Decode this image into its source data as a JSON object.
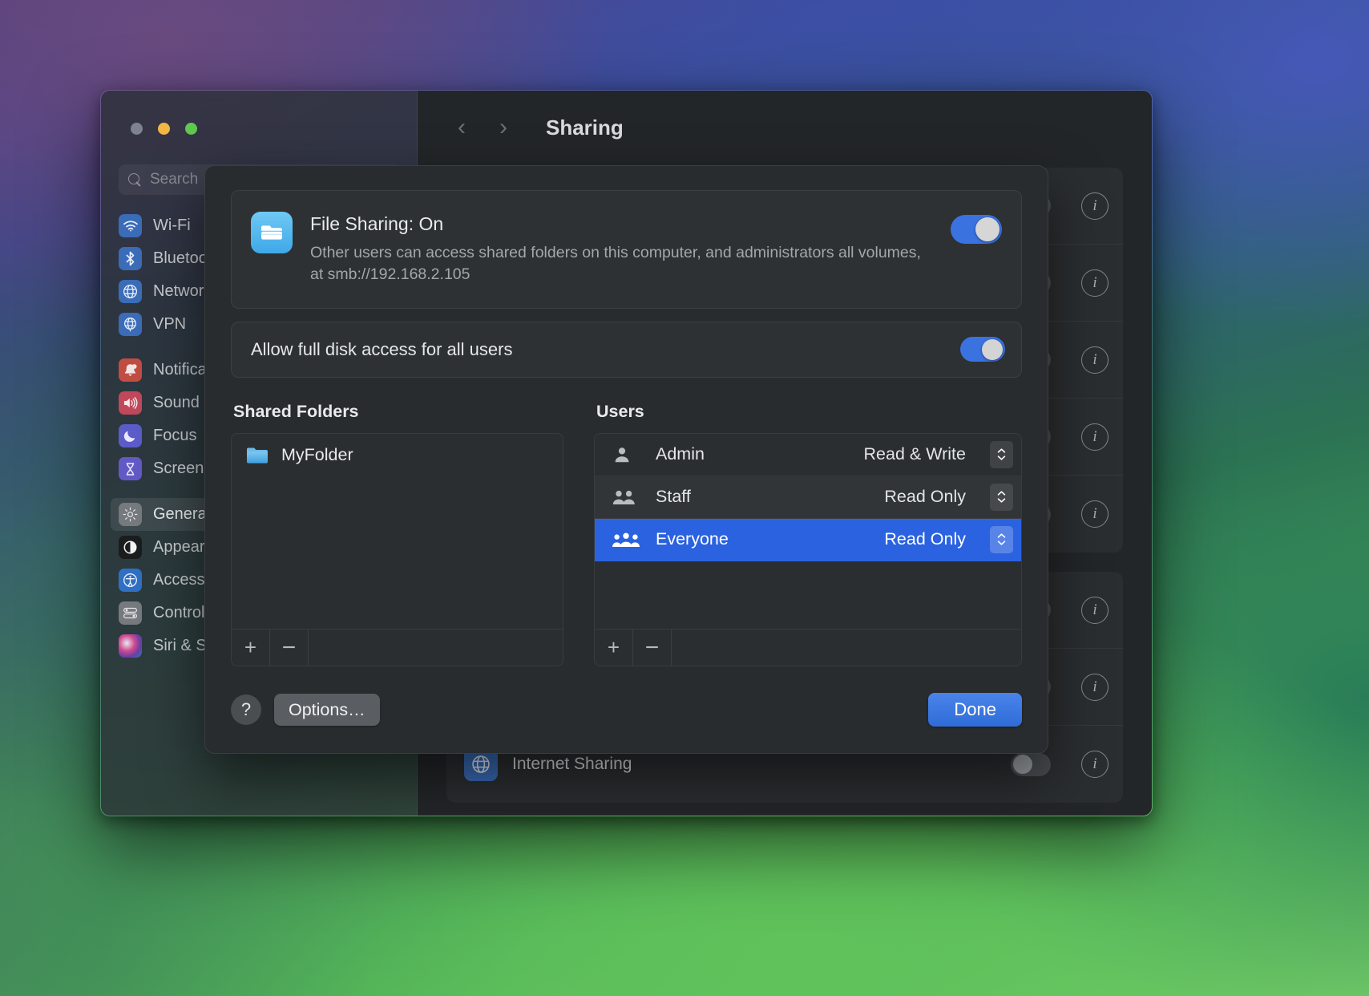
{
  "window": {
    "title": "Sharing",
    "traffic_lights": [
      "close",
      "minimize",
      "zoom"
    ],
    "nav_back": "‹",
    "nav_forward": "›"
  },
  "search": {
    "placeholder": "Search"
  },
  "sidebar": {
    "groups": [
      {
        "items": [
          {
            "label": "Wi-Fi",
            "icon": "wifi-icon",
            "color": "#3a6cb8",
            "glyph": "◔",
            "selected": false
          },
          {
            "label": "Bluetooth",
            "icon": "bluetooth-icon",
            "color": "#3a6cb8",
            "glyph": "ᛦ",
            "selected": false
          },
          {
            "label": "Network",
            "icon": "globe-icon",
            "color": "#3a6cb8",
            "glyph": "ἱ0",
            "selected": false
          },
          {
            "label": "VPN",
            "icon": "vpn-globe-icon",
            "color": "#3a6cb8",
            "glyph": "ἱ0",
            "selected": false
          }
        ]
      },
      {
        "items": [
          {
            "label": "Notifications",
            "icon": "bell-icon",
            "color": "#c14d42",
            "glyph": "ὑ4",
            "selected": false
          },
          {
            "label": "Sound",
            "icon": "speaker-icon",
            "color": "#c0485a",
            "glyph": "ὐa",
            "selected": false
          },
          {
            "label": "Focus",
            "icon": "moon-icon",
            "color": "#5b5bc9",
            "glyph": "ἱ9",
            "selected": false
          },
          {
            "label": "Screen Time",
            "icon": "hourglass-icon",
            "color": "#6359c6",
            "glyph": "⌛",
            "selected": false
          }
        ]
      },
      {
        "items": [
          {
            "label": "General",
            "icon": "gear-icon",
            "color": "#76797d",
            "glyph": "⚙",
            "selected": true
          },
          {
            "label": "Appearance",
            "icon": "contrast-icon",
            "color": "#1b1c1e",
            "glyph": "◑",
            "selected": false
          },
          {
            "label": "Accessibility",
            "icon": "accessibility-icon",
            "color": "#2f6fc4",
            "glyph": "♿",
            "selected": false
          },
          {
            "label": "Control Centre",
            "icon": "sliders-icon",
            "color": "#76797d",
            "glyph": "≣",
            "selected": false
          },
          {
            "label": "Siri & Spotlight",
            "icon": "siri-icon",
            "color": "#9b3a86",
            "glyph": "●",
            "selected": false
          }
        ]
      }
    ]
  },
  "background_rows": [
    {
      "label": "",
      "icon": "generic-icon",
      "color": "#3a6cb8",
      "glyph": "",
      "toggle": "off",
      "info": "i"
    },
    {
      "label": "",
      "icon": "generic-icon",
      "color": "#3a6cb8",
      "glyph": "",
      "toggle": "off",
      "info": "i"
    },
    {
      "label": "",
      "icon": "generic-icon",
      "color": "#3a6cb8",
      "glyph": "",
      "toggle": "off",
      "info": "i"
    },
    {
      "label": "",
      "icon": "generic-icon",
      "color": "#3a6cb8",
      "glyph": "",
      "toggle": "off",
      "info": "i"
    },
    {
      "label": "",
      "icon": "generic-icon",
      "color": "#3a6cb8",
      "glyph": "",
      "toggle": "off",
      "info": "i"
    }
  ],
  "background_rows_2": [
    {
      "label": "",
      "icon": "generic-icon",
      "color": "#3a6cb8",
      "glyph": "",
      "toggle": "off",
      "info": "i"
    },
    {
      "label": "",
      "icon": "generic-icon",
      "color": "#3a6cb8",
      "glyph": "",
      "toggle": "off",
      "info": "i"
    },
    {
      "label": "Internet Sharing",
      "icon": "globe-icon",
      "color": "#3a6cb8",
      "glyph": "ἱ0",
      "toggle": "off",
      "info": "i"
    }
  ],
  "sheet": {
    "file_sharing": {
      "icon": "file-sharing-folder-icon",
      "title": "File Sharing: On",
      "description": "Other users can access shared folders on this computer, and administrators all volumes, at smb://192.168.2.105",
      "toggle_state": "on",
      "toggle_color": "#3a72e0"
    },
    "full_disk": {
      "label": "Allow full disk access for all users",
      "toggle_state": "on",
      "toggle_color": "#3a72e0"
    },
    "shared_folders": {
      "header": "Shared Folders",
      "items": [
        {
          "name": "MyFolder",
          "icon": "folder-icon"
        }
      ],
      "add_label": "+",
      "remove_label": "−"
    },
    "users": {
      "header": "Users",
      "items": [
        {
          "name": "Admin",
          "permission": "Read & Write",
          "icon": "single-person-icon",
          "selected": false
        },
        {
          "name": "Staff",
          "permission": "Read Only",
          "icon": "two-person-icon",
          "selected": false
        },
        {
          "name": "Everyone",
          "permission": "Read Only",
          "icon": "three-person-icon",
          "selected": true
        }
      ],
      "add_label": "+",
      "remove_label": "−",
      "selection_color": "#2b62e0"
    },
    "footer": {
      "help_label": "?",
      "options_label": "Options…",
      "done_label": "Done",
      "done_color": "#2f6cd8"
    }
  }
}
